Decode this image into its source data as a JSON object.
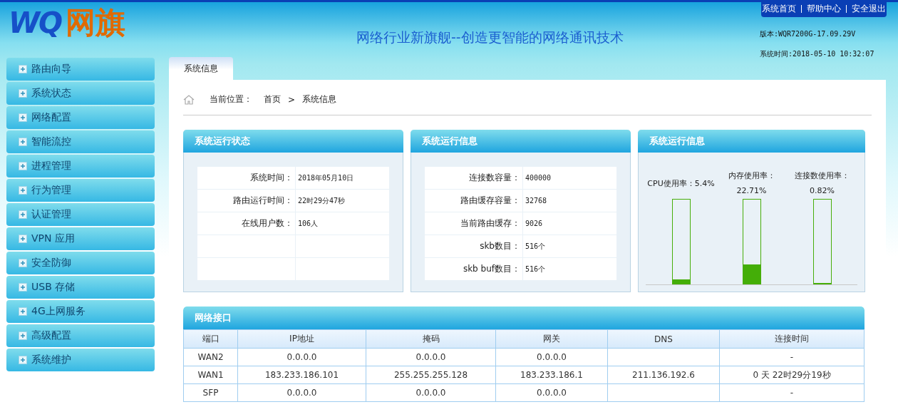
{
  "header": {
    "logo_mark": "WQ",
    "logo_name": "网旗",
    "slogan": "网络行业新旗舰--创造更智能的网络通讯技术",
    "top_links": [
      "系统首页",
      "帮助中心",
      "安全退出"
    ],
    "version": "版本:WQR7200G-17.09.29V",
    "system_time": "系统时间:2018-05-10 10:32:07"
  },
  "sidebar": {
    "items": [
      {
        "label": "路由向导",
        "expanded": false
      },
      {
        "label": "系统状态",
        "expanded": false
      },
      {
        "label": "网络配置",
        "expanded": false
      },
      {
        "label": "智能流控",
        "expanded": false
      },
      {
        "label": "进程管理",
        "expanded": false
      },
      {
        "label": "行为管理",
        "expanded": false
      },
      {
        "label": "认证管理",
        "expanded": false
      },
      {
        "label": "VPN 应用",
        "expanded": false
      },
      {
        "label": "安全防御",
        "expanded": false
      },
      {
        "label": "USB 存储",
        "expanded": false
      },
      {
        "label": "4G上网服务",
        "expanded": false
      },
      {
        "label": "高级配置",
        "expanded": false
      },
      {
        "label": "系统维护",
        "expanded": false
      }
    ]
  },
  "tabs": [
    {
      "label": "系统信息",
      "selected": true
    }
  ],
  "breadcrumb": {
    "prefix": "当前位置：",
    "items": [
      "首页",
      "系统信息"
    ],
    "separator": ">"
  },
  "panels": [
    {
      "title": "系统运行状态",
      "rows": [
        {
          "label": "系统时间：",
          "value": "2018年05月10日"
        },
        {
          "label": "路由运行时间：",
          "value": "22时29分47秒"
        },
        {
          "label": "在线用户数：",
          "value": "106人"
        },
        {},
        {}
      ]
    },
    {
      "title": "系统运行信息",
      "rows": [
        {
          "label": "连接数容量：",
          "value": "400000"
        },
        {
          "label": "路由缓存容量：",
          "value": "32768"
        },
        {
          "label": "当前路由缓存：",
          "value": "9026"
        },
        {
          "label": "skb数目：",
          "value": "516个"
        },
        {
          "label": "skb buf数目：",
          "value": "516个"
        }
      ]
    }
  ],
  "usage_panel": {
    "title": "系统运行信息",
    "meters": [
      {
        "label": "CPU使用率：5.4%",
        "level": 0.054
      },
      {
        "label": "内存使用率：22.71%",
        "level": 0.2271
      },
      {
        "label": "连接数使用率：0.82%",
        "level": 0.0082
      }
    ]
  },
  "interfaces": {
    "title": "网络接口",
    "columns": [
      "端口",
      "IP地址",
      "掩码",
      "网关",
      "DNS",
      "连接时间"
    ],
    "rows": [
      [
        "WAN2",
        "0.0.0.0",
        "0.0.0.0",
        "0.0.0.0",
        "",
        "-"
      ],
      [
        "WAN1",
        "183.233.186.101",
        "255.255.255.128",
        "183.233.186.1",
        "211.136.192.6",
        "0 天 22时29分19秒"
      ],
      [
        "SFP",
        "0.0.0.0",
        "0.0.0.0",
        "0.0.0.0",
        "",
        "-"
      ]
    ]
  }
}
